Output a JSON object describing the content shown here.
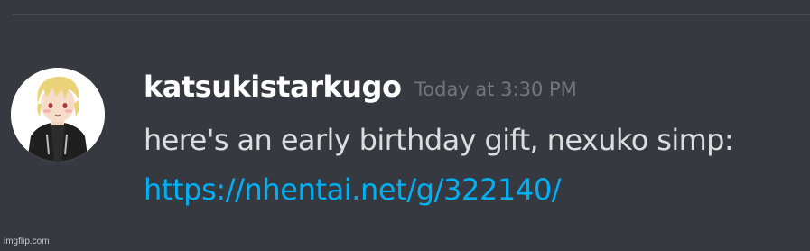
{
  "message": {
    "username": "katsukistarkugo",
    "timestamp": "Today at 3:30 PM",
    "content": "here's an early birthday gift, nexuko simp:",
    "link": "https://nhentai.net/g/322140/",
    "avatar_icon": "user-avatar-icon"
  },
  "watermark": "imgflip.com",
  "colors": {
    "background": "#36393f",
    "username": "#ffffff",
    "timestamp": "#72767d",
    "content": "#dcddde",
    "link": "#00b0f4"
  }
}
